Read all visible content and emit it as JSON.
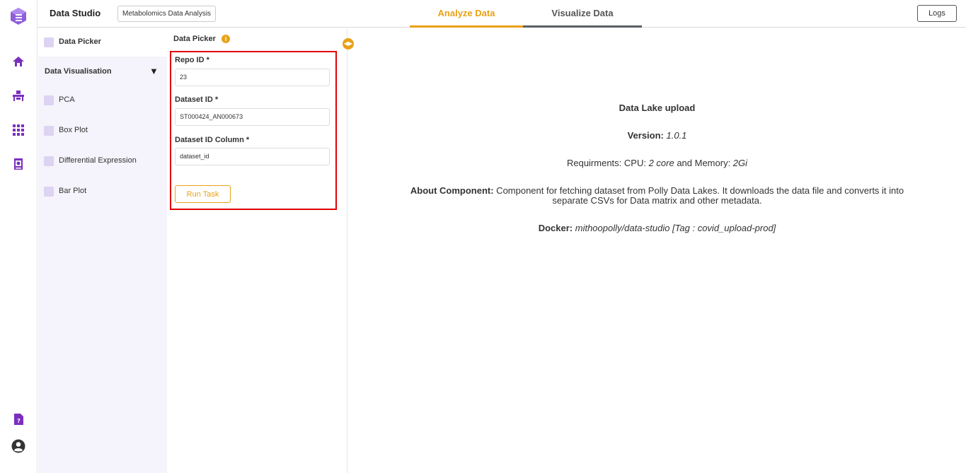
{
  "header": {
    "app_title": "Data Studio",
    "project_value": "Metabolomics Data Analysis",
    "tabs": [
      {
        "label": "Analyze Data",
        "active": true
      },
      {
        "label": "Visualize Data",
        "active": false
      }
    ],
    "logs_label": "Logs",
    "accent_color": "#e8a118"
  },
  "rail": {
    "icons": [
      "app-logo-icon",
      "home-icon",
      "workstation-icon",
      "apps-grid-icon",
      "notebook-icon",
      "help-doc-icon",
      "user-account-icon"
    ],
    "color": "#7b2fbe"
  },
  "sidebar": {
    "data_picker": "Data Picker",
    "group_label": "Data Visualisation",
    "group_arrow": "▼",
    "items": [
      {
        "label": "PCA"
      },
      {
        "label": "Box Plot"
      },
      {
        "label": "Differential Expression"
      },
      {
        "label": "Bar Plot"
      }
    ]
  },
  "panel": {
    "title": "Data Picker",
    "info_glyph": "i",
    "fields": [
      {
        "label": "Repo ID *",
        "value": "23"
      },
      {
        "label": "Dataset ID *",
        "value": "ST000424_AN000673"
      },
      {
        "label": "Dataset ID Column *",
        "value": "dataset_id"
      }
    ],
    "run_label": "Run Task"
  },
  "details": {
    "title": "Data Lake upload",
    "version_label": "Version:",
    "version_value": "1.0.1",
    "req_prefix": "Requirments: CPU: ",
    "cpu": "2 core",
    "req_mid": " and Memory: ",
    "memory": "2Gi",
    "about_label": "About Component:",
    "about_text": " Component for fetching dataset from Polly Data Lakes. It downloads the data file and converts it into",
    "about_text2": "separate CSVs for Data matrix and other metadata.",
    "docker_label": "Docker:",
    "docker_value": "mithoopolly/data-studio [Tag : covid_upload-prod]"
  }
}
